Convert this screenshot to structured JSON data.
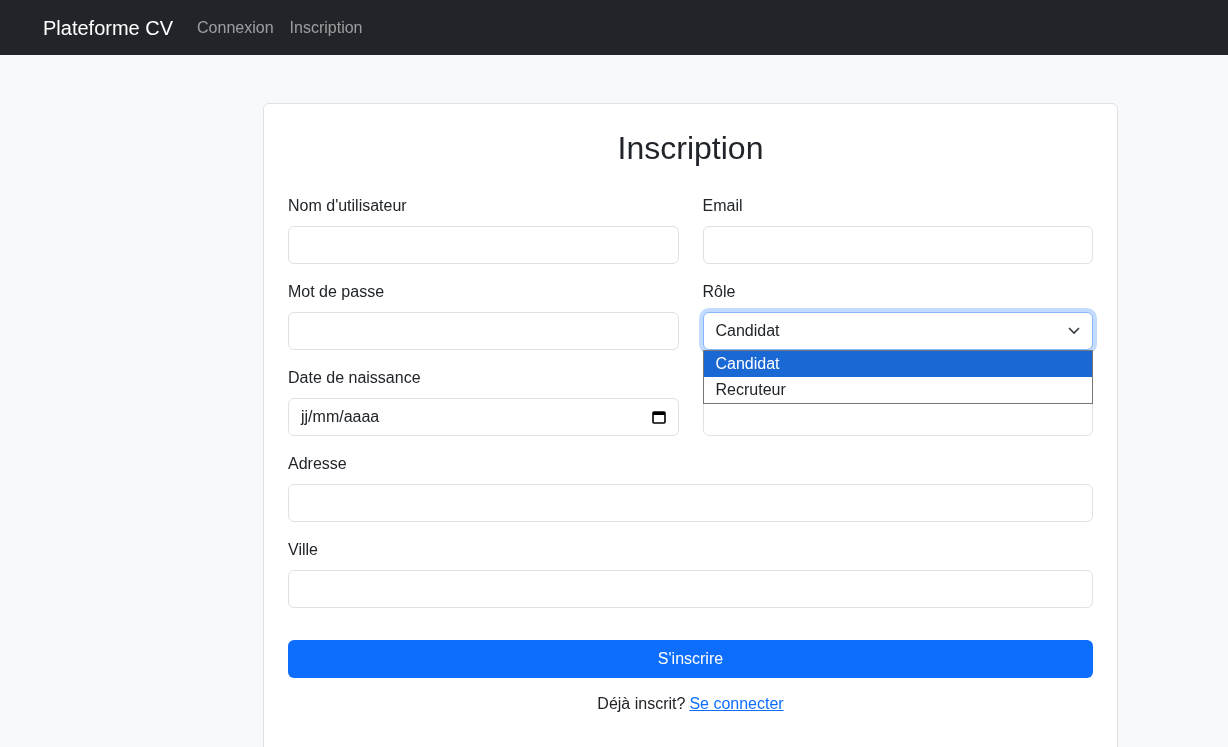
{
  "navbar": {
    "brand": "Plateforme CV",
    "links": [
      {
        "label": "Connexion",
        "selected": false
      },
      {
        "label": "Inscription",
        "selected": false
      }
    ]
  },
  "form": {
    "title": "Inscription",
    "fields": [
      {
        "kind": "text",
        "label": "Nom d'utilisateur",
        "wide": false
      },
      {
        "kind": "text",
        "label": "Email",
        "wide": false
      },
      {
        "kind": "text",
        "label": "Mot de passe",
        "wide": false
      },
      {
        "kind": "select",
        "label": "Rôle",
        "wide": false,
        "value": "Candidat",
        "open": true,
        "options": [
          {
            "label": "Candidat",
            "selected": true
          },
          {
            "label": "Recruteur",
            "selected": false
          }
        ]
      },
      {
        "kind": "date",
        "label": "Date de naissance",
        "wide": false,
        "placeholder": "jj/mm/aaaa"
      },
      {
        "kind": "text",
        "wide": false
      },
      {
        "kind": "text",
        "label": "Adresse",
        "wide": true
      },
      {
        "kind": "text",
        "label": "Ville",
        "wide": true
      }
    ],
    "submit": "S'inscrire",
    "footer": {
      "text": "Déjà inscrit?",
      "link": "Se connecter"
    }
  }
}
